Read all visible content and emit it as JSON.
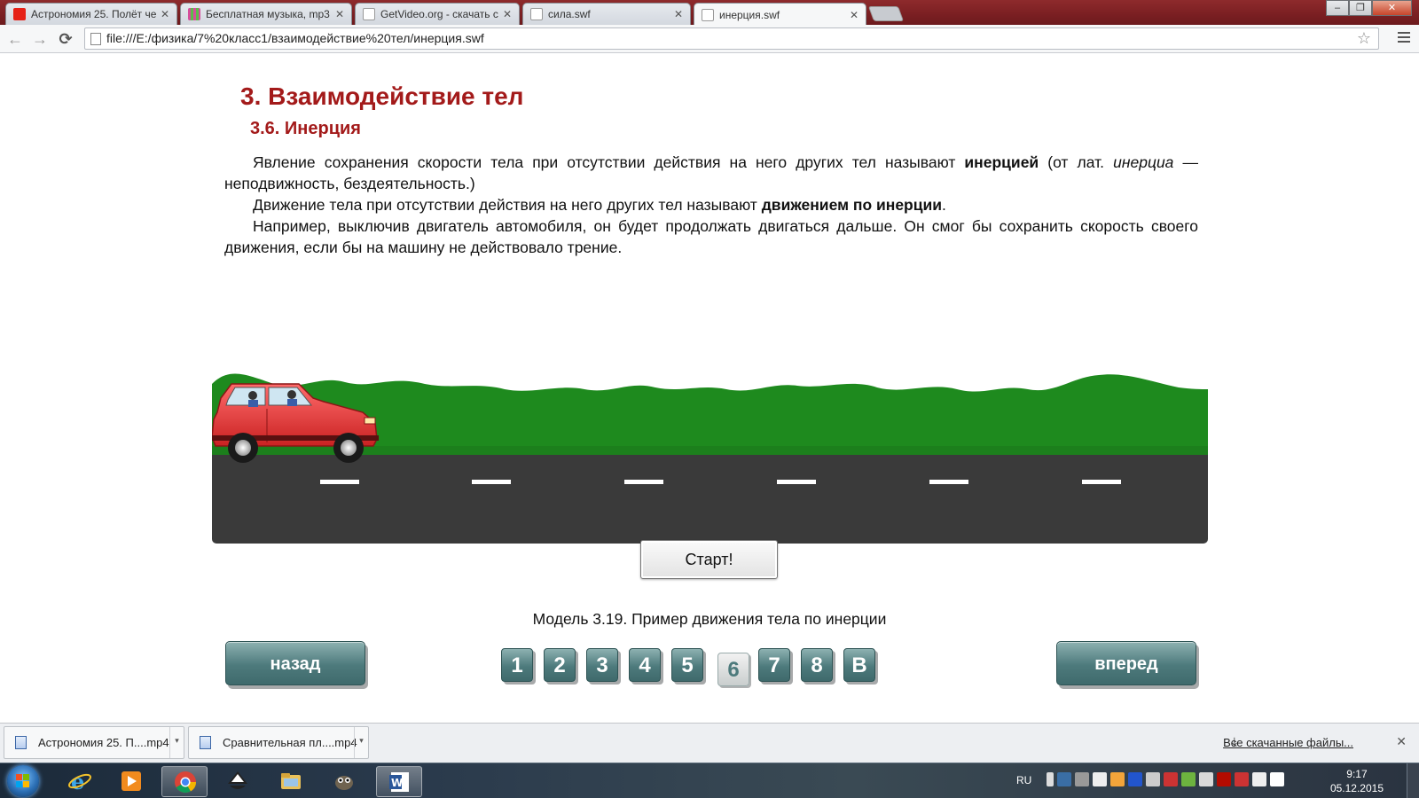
{
  "browser": {
    "tabs": [
      {
        "title": "Астрономия 25. Полёт че",
        "favicon_color": "#e62117"
      },
      {
        "title": "Бесплатная музыка, mp3",
        "favicon_color": "#d64e9b"
      },
      {
        "title": "GetVideo.org - скачать с у",
        "favicon_color": "#9aa0a6"
      },
      {
        "title": "сила.swf",
        "favicon_color": "#9aa0a6"
      },
      {
        "title": "инерция.swf",
        "favicon_color": "#9aa0a6"
      }
    ],
    "active_tab_index": 4,
    "url": "file:///E:/физика/7%20класс1/взаимодействие%20тел/инерция.swf",
    "nav": {
      "back": "←",
      "forward": "→",
      "reload": "⟳",
      "star": "☆"
    },
    "window_buttons": {
      "minimize": "–",
      "maximize": "❐",
      "close": "✕"
    }
  },
  "page": {
    "title": "3. Взаимодействие тел",
    "subtitle": "3.6. Инерция",
    "p1": {
      "text_a": "Явление сохранения скорости тела при отсутствии действия на него других тел называют ",
      "bold": "инерцией",
      "text_b": " (от лат. ",
      "italic": "инерциа",
      "text_c": " — неподвижность, бездеятельность.)"
    },
    "p2": {
      "text_a": "Движение тела при отсутствии действия на него других тел называют ",
      "bold": "движением по инерции",
      "text_b": "."
    },
    "p3": {
      "text": "Например, выключив двигатель автомобиля, он будет продолжать двигаться дальше. Он смог бы сохранить скорость своего движения, если бы на машину не действовало трение."
    },
    "start_button": "Старт!",
    "caption": "Модель 3.19. Пример движения тела по инерции",
    "back_button": "назад",
    "forward_button": "вперед",
    "pages": [
      "1",
      "2",
      "3",
      "4",
      "5",
      "6",
      "7",
      "8",
      "В"
    ],
    "current_page_index": 5,
    "colors": {
      "heading": "#a31a1a",
      "button": "#4d7a7c",
      "grass": "#1e8a1e",
      "road": "#3a3a3a",
      "car": "#e23b3b"
    }
  },
  "downloads": {
    "items": [
      {
        "name": "Астрономия 25. П....mp4"
      },
      {
        "name": "Сравнительная пл....mp4"
      }
    ],
    "all_downloads": "Все скачанные файлы...",
    "close": "✕"
  },
  "taskbar": {
    "language": "RU",
    "time": "9:17",
    "date": "05.12.2015",
    "apps": [
      "internet-explorer",
      "media-player",
      "chrome",
      "inkscape",
      "file-explorer",
      "gimp",
      "word"
    ],
    "active_app": "chrome"
  }
}
